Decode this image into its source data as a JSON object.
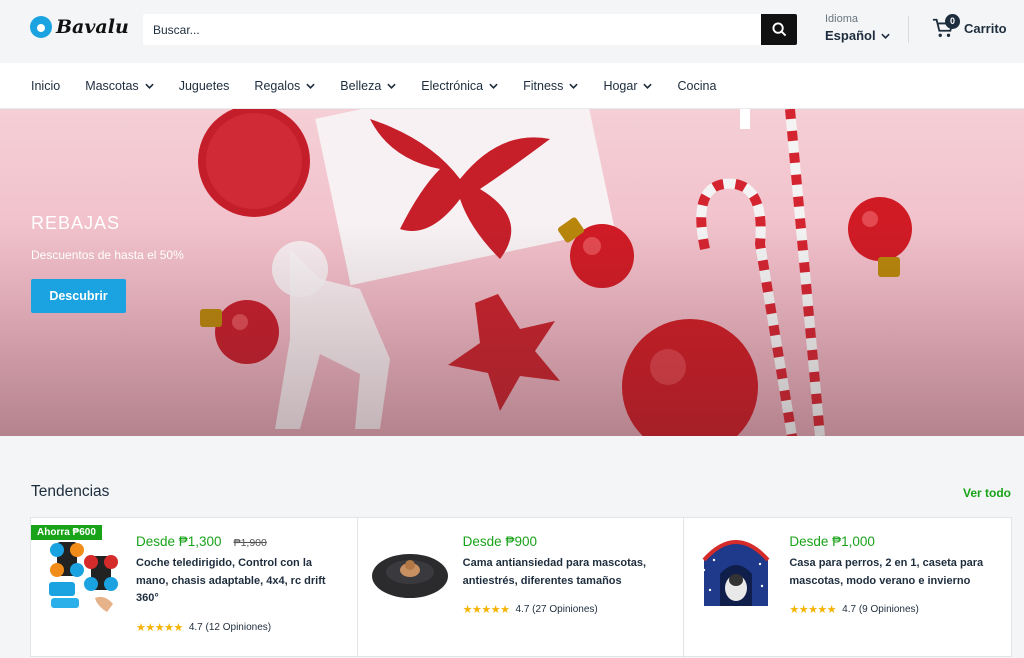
{
  "header": {
    "logo_text": "Bavalu",
    "search_placeholder": "Buscar...",
    "language_label": "Idioma",
    "language_value": "Español",
    "cart_count": "0",
    "cart_label": "Carrito"
  },
  "nav": {
    "items": [
      {
        "label": "Inicio",
        "dropdown": false
      },
      {
        "label": "Mascotas",
        "dropdown": true
      },
      {
        "label": "Juguetes",
        "dropdown": false
      },
      {
        "label": "Regalos",
        "dropdown": true
      },
      {
        "label": "Belleza",
        "dropdown": true
      },
      {
        "label": "Electrónica",
        "dropdown": true
      },
      {
        "label": "Fitness",
        "dropdown": true
      },
      {
        "label": "Hogar",
        "dropdown": true
      },
      {
        "label": "Cocina",
        "dropdown": false
      }
    ]
  },
  "hero": {
    "title": "REBAJAS",
    "subtitle": "Descuentos de hasta el 50%",
    "button_label": "Descubrir"
  },
  "trending": {
    "title": "Tendencias",
    "see_all": "Ver todo",
    "products": [
      {
        "badge": "Ahorra ₱600",
        "price": "Desde ₱1,300",
        "old_price": "₱1,900",
        "name": "Coche teledirigido, Control con la mano, chasis adaptable, 4x4, rc drift 360°",
        "rating": 4.7,
        "rating_text": "4.7 (12 Opiniones)"
      },
      {
        "price": "Desde ₱900",
        "name": "Cama antiansiedad para mascotas, antiestrés, diferentes tamaños",
        "rating": 4.7,
        "rating_text": "4.7 (27 Opiniones)"
      },
      {
        "price": "Desde ₱1,000",
        "name": "Casa para perros, 2 en 1, caseta para mascotas, modo verano e invierno",
        "rating": 4.7,
        "rating_text": "4.7 (9 Opiniones)"
      }
    ]
  },
  "colors": {
    "accent": "#1aa3e0",
    "green": "#19a319",
    "dark": "#1e2d3d"
  }
}
